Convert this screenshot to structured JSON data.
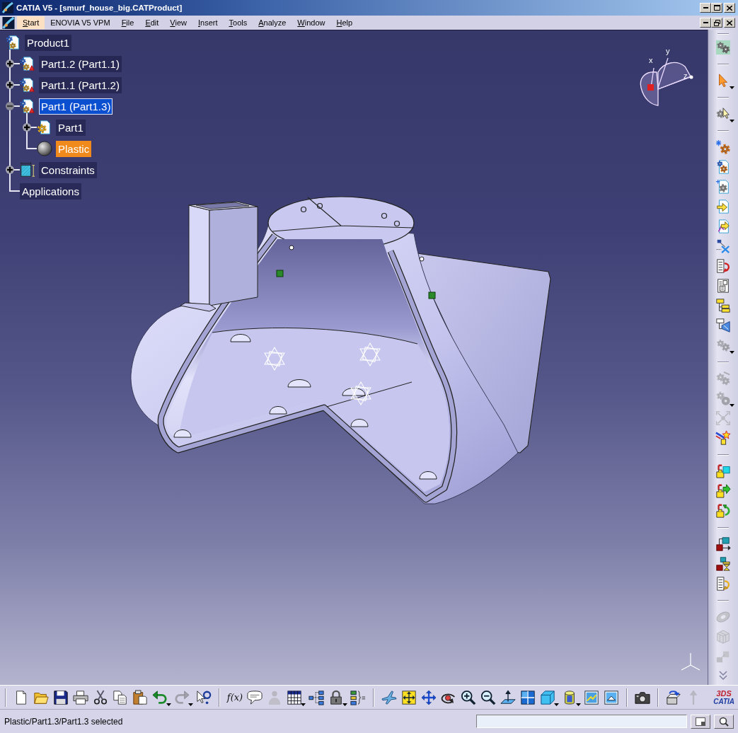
{
  "window": {
    "title": "CATIA V5 - [smurf_house_big.CATProduct]"
  },
  "menu": [
    {
      "label": "Start",
      "selected": true,
      "access_key_underlined": true
    },
    {
      "label": "ENOVIA V5 VPM",
      "selected": false,
      "access_key_underlined": false
    },
    {
      "label": "File",
      "selected": false,
      "access_key_underlined": true
    },
    {
      "label": "Edit",
      "selected": false,
      "access_key_underlined": true
    },
    {
      "label": "View",
      "selected": false,
      "access_key_underlined": true
    },
    {
      "label": "Insert",
      "selected": false,
      "access_key_underlined": true
    },
    {
      "label": "Tools",
      "selected": false,
      "access_key_underlined": true
    },
    {
      "label": "Analyze",
      "selected": false,
      "access_key_underlined": true
    },
    {
      "label": "Window",
      "selected": false,
      "access_key_underlined": true
    },
    {
      "label": "Help",
      "selected": false,
      "access_key_underlined": true
    }
  ],
  "tree": [
    {
      "label": "Product1",
      "kind": "product",
      "selected": false,
      "active": false,
      "children": [
        {
          "label": "Part1.2 (Part1.1)",
          "kind": "component",
          "expanded": false,
          "selected": false,
          "active": false
        },
        {
          "label": "Part1.1 (Part1.2)",
          "kind": "component",
          "expanded": false,
          "selected": false,
          "active": false
        },
        {
          "label": "Part1 (Part1.3)",
          "kind": "component",
          "expanded": true,
          "selected": false,
          "active": true,
          "children": [
            {
              "label": "Part1",
              "kind": "part",
              "expanded": false,
              "selected": false,
              "active": false
            },
            {
              "label": "Plastic",
              "kind": "material",
              "selected": true,
              "active": false
            }
          ]
        },
        {
          "label": "Constraints",
          "kind": "constraints",
          "expanded": false,
          "selected": false,
          "active": false
        },
        {
          "label": "Applications",
          "kind": "node",
          "selected": false,
          "active": false
        }
      ]
    }
  ],
  "compass": {
    "axes": [
      "x",
      "y",
      "z"
    ]
  },
  "right_toolbar": [
    {
      "buttons": [
        {
          "disabled": false,
          "dropdown": false
        }
      ]
    },
    {
      "buttons": [
        {
          "disabled": false,
          "dropdown": true
        }
      ]
    },
    {
      "buttons": [
        {
          "disabled": false,
          "dropdown": true
        }
      ]
    },
    {
      "buttons": [
        {
          "disabled": false,
          "dropdown": false
        },
        {
          "disabled": false,
          "dropdown": false
        },
        {
          "disabled": false,
          "dropdown": false
        },
        {
          "disabled": false,
          "dropdown": false
        },
        {
          "disabled": false,
          "dropdown": false
        },
        {
          "disabled": false,
          "dropdown": false
        },
        {
          "disabled": false,
          "dropdown": false
        },
        {
          "disabled": false,
          "dropdown": false
        },
        {
          "disabled": false,
          "dropdown": false
        },
        {
          "disabled": false,
          "dropdown": false
        },
        {
          "disabled": true,
          "dropdown": true
        }
      ]
    },
    {
      "buttons": [
        {
          "disabled": true,
          "dropdown": false
        },
        {
          "disabled": true,
          "dropdown": true
        },
        {
          "disabled": true,
          "dropdown": false
        },
        {
          "disabled": false,
          "dropdown": false
        }
      ]
    },
    {
      "buttons": [
        {
          "disabled": false,
          "dropdown": false
        },
        {
          "disabled": false,
          "dropdown": false
        },
        {
          "disabled": false,
          "dropdown": false
        }
      ]
    },
    {
      "buttons": [
        {
          "disabled": false,
          "dropdown": false
        },
        {
          "disabled": false,
          "dropdown": false
        },
        {
          "disabled": false,
          "dropdown": false
        }
      ]
    },
    {
      "buttons": [
        {
          "disabled": true,
          "dropdown": false
        },
        {
          "disabled": true,
          "dropdown": false
        },
        {
          "disabled": true,
          "dropdown": false
        }
      ]
    }
  ],
  "bottom_toolbar": [
    {
      "buttons": [
        {
          "disabled": false,
          "dropdown": false
        },
        {
          "disabled": false,
          "dropdown": false
        },
        {
          "disabled": false,
          "dropdown": false
        },
        {
          "disabled": false,
          "dropdown": false
        },
        {
          "disabled": false,
          "dropdown": false
        },
        {
          "disabled": false,
          "dropdown": false
        },
        {
          "disabled": false,
          "dropdown": false
        },
        {
          "disabled": false,
          "dropdown": true
        },
        {
          "disabled": true,
          "dropdown": true
        },
        {
          "disabled": false,
          "dropdown": false
        }
      ]
    },
    {
      "buttons": [
        {
          "label": "f(x)",
          "disabled": false,
          "dropdown": false
        },
        {
          "disabled": false,
          "dropdown": false
        },
        {
          "disabled": true,
          "dropdown": false
        },
        {
          "disabled": false,
          "dropdown": true
        },
        {
          "disabled": false,
          "dropdown": false
        },
        {
          "disabled": false,
          "dropdown": true
        },
        {
          "disabled": false,
          "dropdown": false
        }
      ]
    },
    {
      "buttons": [
        {
          "disabled": false,
          "dropdown": false
        },
        {
          "disabled": false,
          "dropdown": false
        },
        {
          "disabled": false,
          "dropdown": false
        },
        {
          "disabled": false,
          "dropdown": false
        },
        {
          "disabled": false,
          "dropdown": false
        },
        {
          "disabled": false,
          "dropdown": false
        },
        {
          "disabled": false,
          "dropdown": false
        },
        {
          "disabled": false,
          "dropdown": false
        },
        {
          "disabled": false,
          "dropdown": true
        },
        {
          "disabled": false,
          "dropdown": true
        },
        {
          "disabled": false,
          "dropdown": false
        },
        {
          "disabled": false,
          "dropdown": false
        }
      ]
    },
    {
      "buttons": [
        {
          "disabled": false,
          "dropdown": false
        }
      ]
    },
    {
      "buttons": [
        {
          "disabled": false,
          "dropdown": false
        },
        {
          "disabled": true,
          "dropdown": false
        }
      ]
    }
  ],
  "logo": {
    "mark": "3DS",
    "name": "CATIA"
  },
  "status_bar": {
    "message": "Plastic/Part1.3/Part1.3 selected"
  }
}
